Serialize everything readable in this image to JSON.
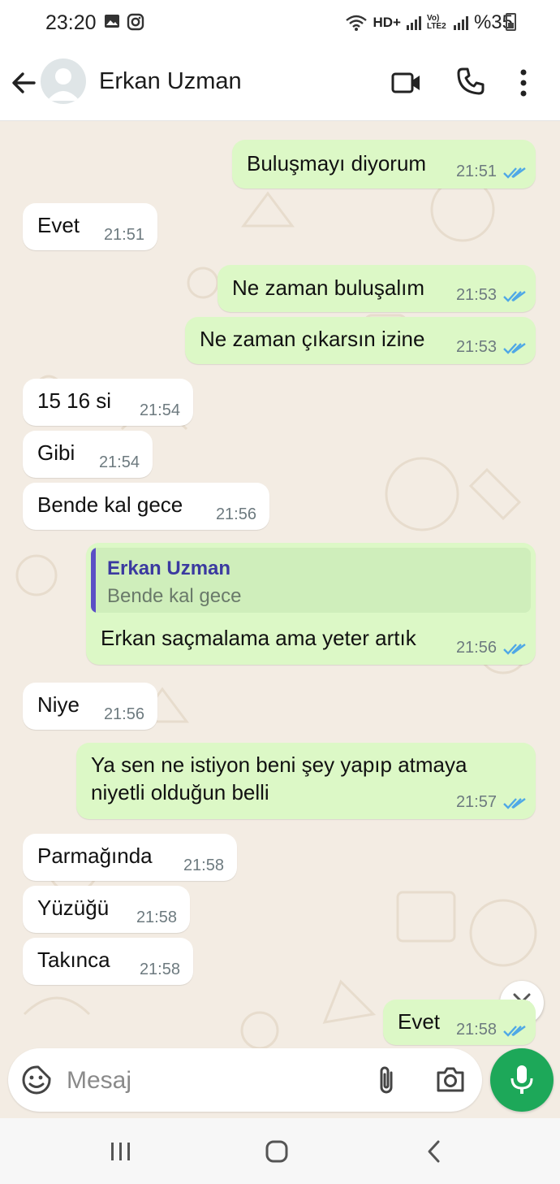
{
  "status_bar": {
    "time": "23:20",
    "network": "HD+",
    "volte": "Vo) LTE2",
    "battery": "%35"
  },
  "header": {
    "contact_name": "Erkan Uzman"
  },
  "messages": [
    {
      "dir": "out",
      "text": "Buluşmayı diyorum",
      "time": "21:51",
      "status": "read"
    },
    {
      "dir": "in",
      "text": "Evet",
      "time": "21:51"
    },
    {
      "dir": "out",
      "text": "Ne zaman buluşalım",
      "time": "21:53",
      "status": "read"
    },
    {
      "dir": "out",
      "text": "Ne zaman çıkarsın izine",
      "time": "21:53",
      "status": "read"
    },
    {
      "dir": "in",
      "text": "15 16 si",
      "time": "21:54"
    },
    {
      "dir": "in",
      "text": "Gibi",
      "time": "21:54"
    },
    {
      "dir": "in",
      "text": "Bende kal gece",
      "time": "21:56"
    },
    {
      "dir": "out",
      "quote": {
        "author": "Erkan Uzman",
        "text": "Bende kal gece"
      },
      "text": "Erkan saçmalama ama yeter artık",
      "time": "21:56",
      "status": "read"
    },
    {
      "dir": "in",
      "text": "Niye",
      "time": "21:56"
    },
    {
      "dir": "out",
      "text_line1": "Ya sen ne istiyon beni şey yapıp atmaya",
      "text_line2": "niyetli olduğun belli",
      "time": "21:57",
      "status": "read"
    },
    {
      "dir": "in",
      "text": "Parmağında",
      "time": "21:58"
    },
    {
      "dir": "in",
      "text": "Yüzüğü",
      "time": "21:58"
    },
    {
      "dir": "in",
      "text": "Takınca",
      "time": "21:58"
    },
    {
      "dir": "out",
      "text": "Evet",
      "time": "21:58",
      "status": "read"
    }
  ],
  "composer": {
    "placeholder": "Mesaj"
  },
  "icons": {
    "back": "arrow-left-icon",
    "video": "video-call-icon",
    "call": "phone-icon",
    "menu": "more-vert-icon",
    "emoji": "sticker-icon",
    "attach": "paperclip-icon",
    "camera": "camera-icon",
    "mic": "mic-icon",
    "scroll": "chevron-double-down-icon"
  },
  "colors": {
    "outgoing_bubble": "#dcf8c6",
    "incoming_bubble": "#ffffff",
    "chat_background": "#f3ece3",
    "read_ticks": "#4fa8e6",
    "mic_button": "#1da859",
    "quote_bar": "#5b4fc6"
  }
}
